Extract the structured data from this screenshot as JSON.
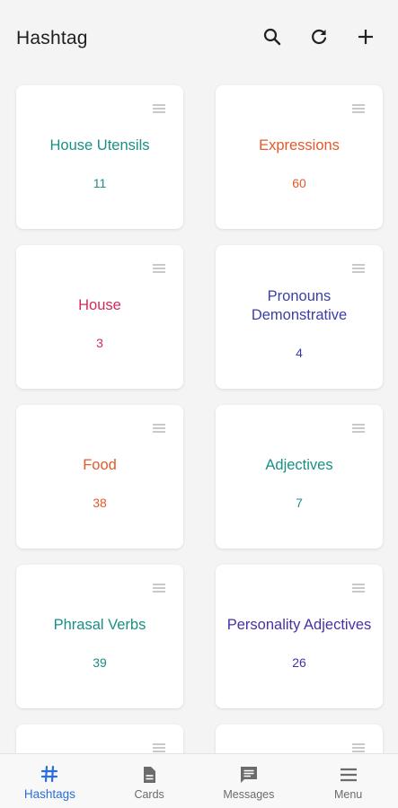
{
  "header": {
    "title": "Hashtag",
    "actions": [
      {
        "icon": "search-icon"
      },
      {
        "icon": "refresh-icon"
      },
      {
        "icon": "add-icon"
      }
    ]
  },
  "cards": [
    {
      "title": "House Utensils",
      "count": "11",
      "color": "#1a8f86"
    },
    {
      "title": "Expressions",
      "count": "60",
      "color": "#e25a2b"
    },
    {
      "title": "House",
      "count": "3",
      "color": "#d32a5c"
    },
    {
      "title": "Pronouns Demonstrative",
      "count": "4",
      "color": "#3c3fa6"
    },
    {
      "title": "Food",
      "count": "38",
      "color": "#e25a2b"
    },
    {
      "title": "Adjectives",
      "count": "7",
      "color": "#1a8f86"
    },
    {
      "title": "Phrasal Verbs",
      "count": "39",
      "color": "#1a8f86"
    },
    {
      "title": "Personality Adjectives",
      "count": "26",
      "color": "#4b2fa6"
    }
  ],
  "bottom_nav": {
    "items": [
      {
        "label": "Hashtags",
        "icon": "hashtag-icon",
        "active": true
      },
      {
        "label": "Cards",
        "icon": "document-icon",
        "active": false
      },
      {
        "label": "Messages",
        "icon": "message-icon",
        "active": false
      },
      {
        "label": "Menu",
        "icon": "menu-icon",
        "active": false
      }
    ],
    "active_color": "#2b6fd6",
    "inactive_color": "#6b6b6b"
  }
}
